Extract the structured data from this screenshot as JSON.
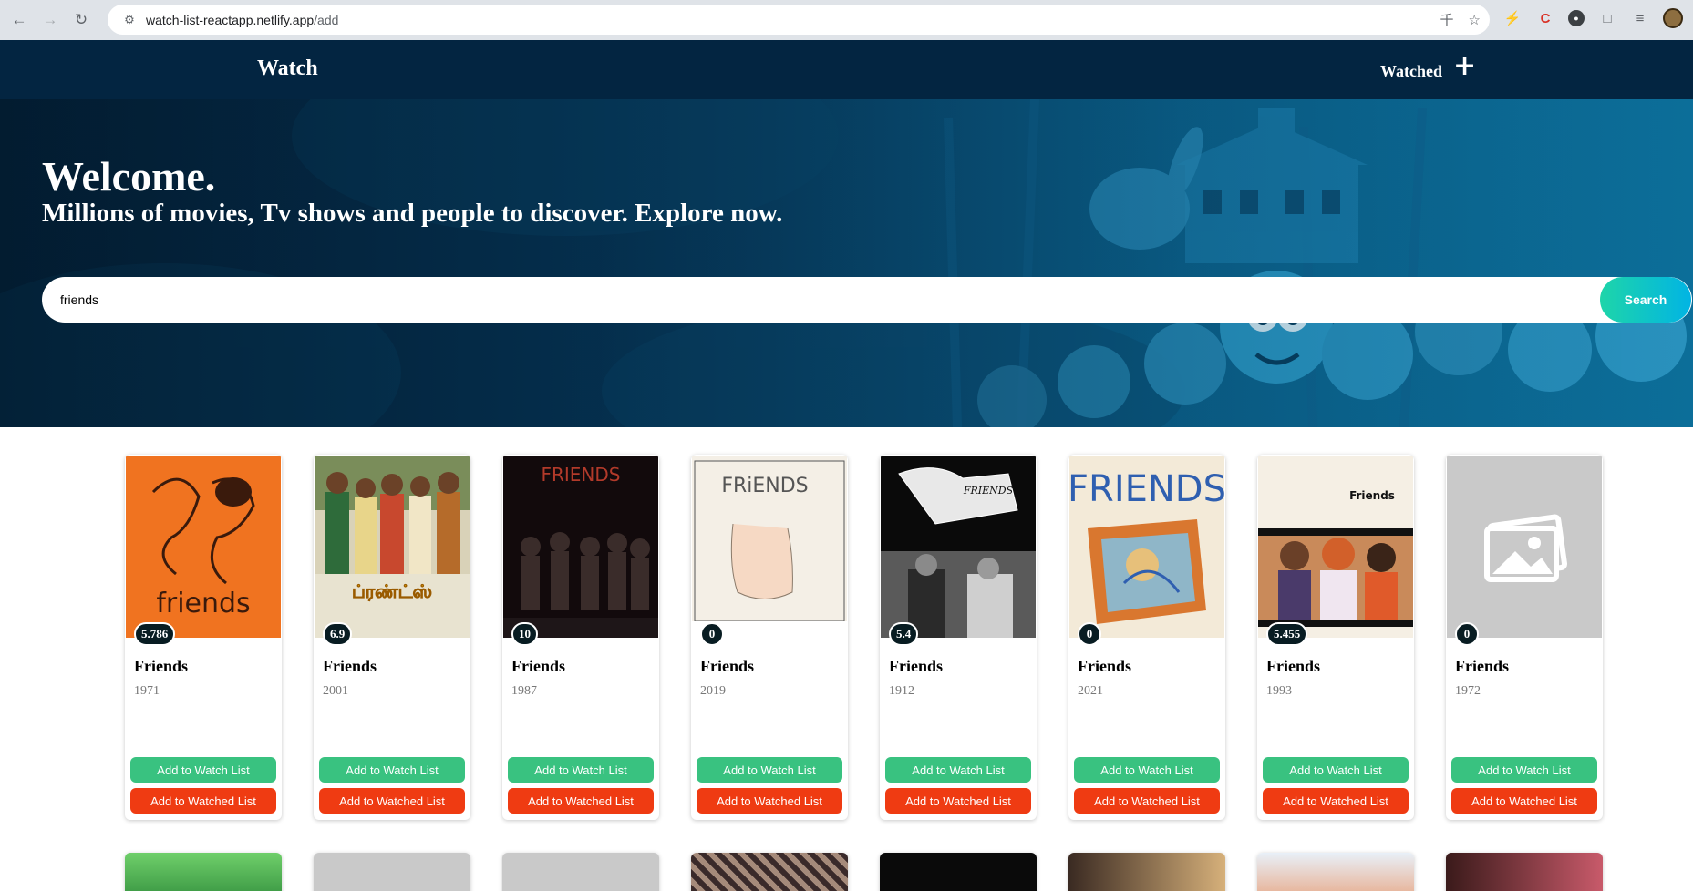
{
  "browser": {
    "url_host": "watch-list-reactapp.netlify.app",
    "url_path": "/add"
  },
  "header": {
    "brand": "Watch",
    "nav_watched": "Watched",
    "nav_add": "+"
  },
  "hero": {
    "title": "Welcome.",
    "subtitle": "Millions of movies, Tv shows and people to discover. Explore now.",
    "search_value": "friends",
    "search_button": "Search"
  },
  "results": [
    {
      "title": "Friends",
      "year": "1971",
      "rating": "5.786",
      "poster_text": "friends"
    },
    {
      "title": "Friends",
      "year": "2001",
      "rating": "6.9",
      "poster_text": "ப்ரண்ட்ஸ்"
    },
    {
      "title": "Friends",
      "year": "1987",
      "rating": "10",
      "poster_text": "FRIENDS"
    },
    {
      "title": "Friends",
      "year": "2019",
      "rating": "0",
      "poster_text": "FRiENDS"
    },
    {
      "title": "Friends",
      "year": "1912",
      "rating": "5.4",
      "poster_text": "FRIENDS"
    },
    {
      "title": "Friends",
      "year": "2021",
      "rating": "0",
      "poster_text": "FRIENDS"
    },
    {
      "title": "Friends",
      "year": "1993",
      "rating": "5.455",
      "poster_text": "Friends"
    },
    {
      "title": "Friends",
      "year": "1972",
      "rating": "0",
      "poster_text": ""
    }
  ],
  "card_buttons": {
    "add_watch": "Add to Watch List",
    "add_watched": "Add to Watched List"
  },
  "colors": {
    "header_bg": "#032541",
    "search_gradient_start": "#1ed5a9",
    "search_gradient_end": "#01b4e4",
    "watch_button": "#39c280",
    "watched_button": "#ef3b12",
    "rating_badge": "#081c22"
  }
}
